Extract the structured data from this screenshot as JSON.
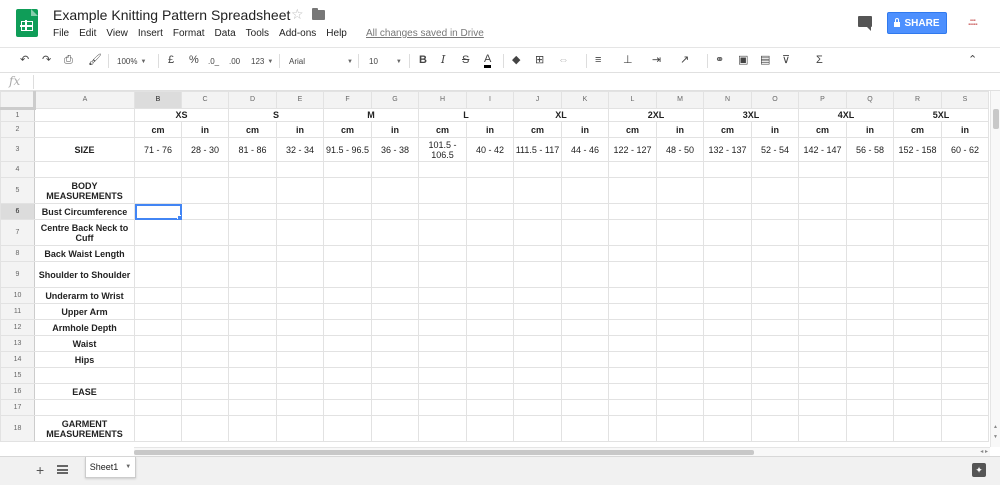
{
  "app": {
    "title": "Example Knitting Pattern Spreadsheet",
    "menus": [
      "File",
      "Edit",
      "View",
      "Insert",
      "Format",
      "Data",
      "Tools",
      "Add-ons",
      "Help"
    ],
    "saved_status": "All changes saved in Drive",
    "share_label": "SHARE",
    "brand_color": "#0f9d58",
    "share_color": "#4d90fe"
  },
  "toolbar": {
    "zoom": "100%",
    "currency": "£",
    "percent": "%",
    "decrease_decimals": ".0_",
    "increase_decimals": ".00",
    "more_formats": "123",
    "font": "Arial",
    "font_size": "10",
    "bold": "B",
    "italic": "I",
    "strikethrough": "S",
    "text_color": "A",
    "function": "Σ"
  },
  "formula_bar": {
    "fx_label": "fx",
    "value": ""
  },
  "sheet": {
    "columns": [
      "A",
      "B",
      "C",
      "D",
      "E",
      "F",
      "G",
      "H",
      "I",
      "J",
      "K",
      "L",
      "M",
      "N",
      "O",
      "P",
      "Q",
      "R",
      "S"
    ],
    "selected_column": "B",
    "selected_row": "6",
    "sizes": [
      "XS",
      "S",
      "M",
      "L",
      "XL",
      "2XL",
      "3XL",
      "4XL",
      "5XL"
    ],
    "units": [
      "cm",
      "in"
    ],
    "size_label": "SIZE",
    "size_values": [
      "71 - 76",
      "28 - 30",
      "81 - 86",
      "32 - 34",
      "91.5 - 96.5",
      "36 - 38",
      "101.5 - 106.5",
      "40 - 42",
      "111.5 - 117",
      "44 - 46",
      "122 - 127",
      "48 - 50",
      "132 - 137",
      "52 - 54",
      "142 - 147",
      "56 - 58",
      "152 - 158",
      "60 - 62"
    ],
    "rows": [
      {
        "num": "1",
        "label": ""
      },
      {
        "num": "2",
        "label": ""
      },
      {
        "num": "3",
        "label": "SIZE"
      },
      {
        "num": "4",
        "label": ""
      },
      {
        "num": "5",
        "label": "BODY MEASUREMENTS"
      },
      {
        "num": "6",
        "label": "Bust Circumference"
      },
      {
        "num": "7",
        "label": "Centre Back Neck to Cuff"
      },
      {
        "num": "8",
        "label": "Back Waist Length"
      },
      {
        "num": "9",
        "label": "Shoulder to Shoulder"
      },
      {
        "num": "10",
        "label": "Underarm to Wrist"
      },
      {
        "num": "11",
        "label": "Upper Arm"
      },
      {
        "num": "12",
        "label": "Armhole Depth"
      },
      {
        "num": "13",
        "label": "Waist"
      },
      {
        "num": "14",
        "label": "Hips"
      },
      {
        "num": "15",
        "label": ""
      },
      {
        "num": "16",
        "label": "EASE"
      },
      {
        "num": "17",
        "label": ""
      },
      {
        "num": "18",
        "label": "GARMENT MEASUREMENTS"
      }
    ]
  },
  "bottom": {
    "sheet_tab": "Sheet1"
  }
}
